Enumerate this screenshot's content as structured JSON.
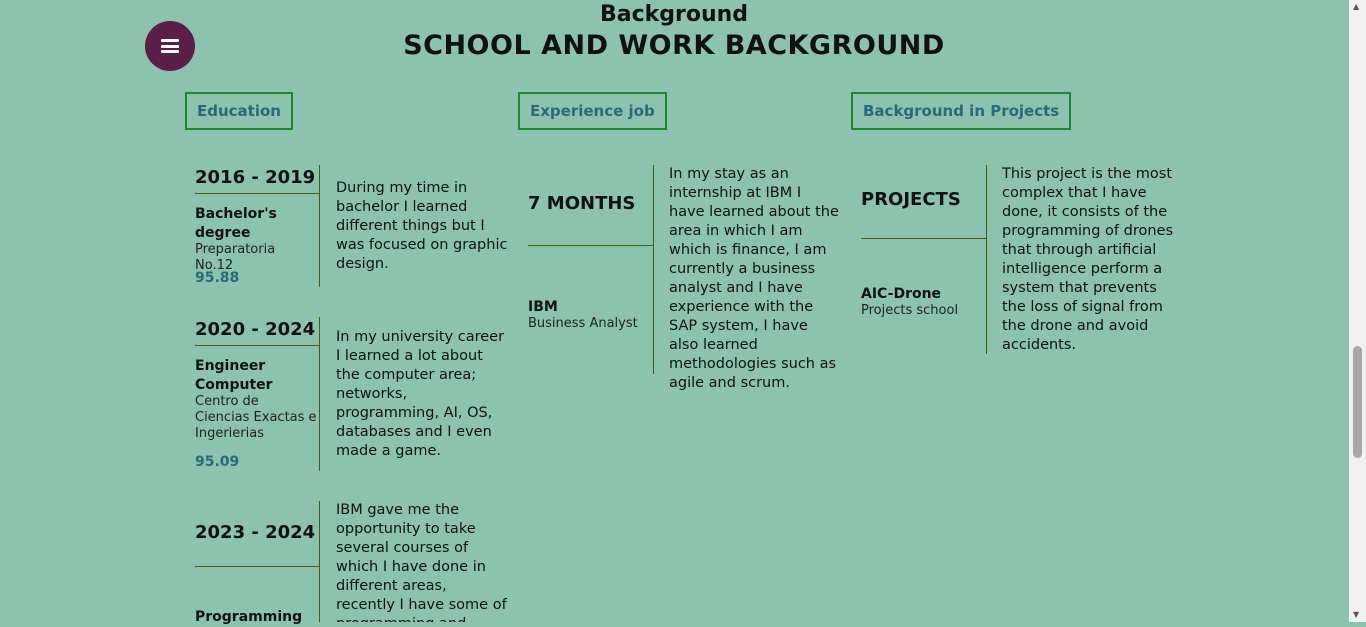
{
  "header": {
    "subtitle": "Background",
    "title": "SCHOOL AND WORK BACKGROUND"
  },
  "tabs": [
    {
      "label": "Education"
    },
    {
      "label": "Experience job"
    },
    {
      "label": "Background in Projects"
    }
  ],
  "education": [
    {
      "years": "2016 - 2019",
      "degree": "Bachelor's degree",
      "institution": "Preparatoria No.12",
      "grade": "95.88",
      "description": "During my time in bachelor I learned different things but I was focused on graphic design."
    },
    {
      "years": "2020 - 2024",
      "degree": "Engineer Computer",
      "institution": "Centro de Ciencias Exactas e Ingerierias",
      "grade": "95.09",
      "description": "In my university career I learned a lot about the computer area; networks, programming, AI, OS, databases and I even made a game."
    },
    {
      "years": "2023 - 2024",
      "degree": "Programming",
      "institution": "",
      "grade": "",
      "description": "IBM gave me the opportunity to take several courses of which I have done in different areas, recently I have some of programming and"
    }
  ],
  "experience": {
    "duration": "7 MONTHS",
    "company": "IBM",
    "role": "Business Analyst",
    "description": "In my stay as an internship at IBM I have learned about the area in which I am which is finance, I am currently a business analyst and I have experience with the SAP system, I have also learned methodologies such as agile and scrum."
  },
  "projects": {
    "heading": "PROJECTS",
    "name": "AIC-Drone",
    "context": "Projects school",
    "description": "This project is the most complex that I have done, it consists of the programming of drones that through artificial intelligence perform a system that prevents the loss of signal from the drone and avoid accidents."
  },
  "icons": {
    "menu": "hamburger-menu-icon"
  },
  "colors": {
    "background": "#8bc3af",
    "menu_button": "#5a1e48",
    "tab_border": "#1f8a2d",
    "accent_text": "#2a6a78"
  }
}
